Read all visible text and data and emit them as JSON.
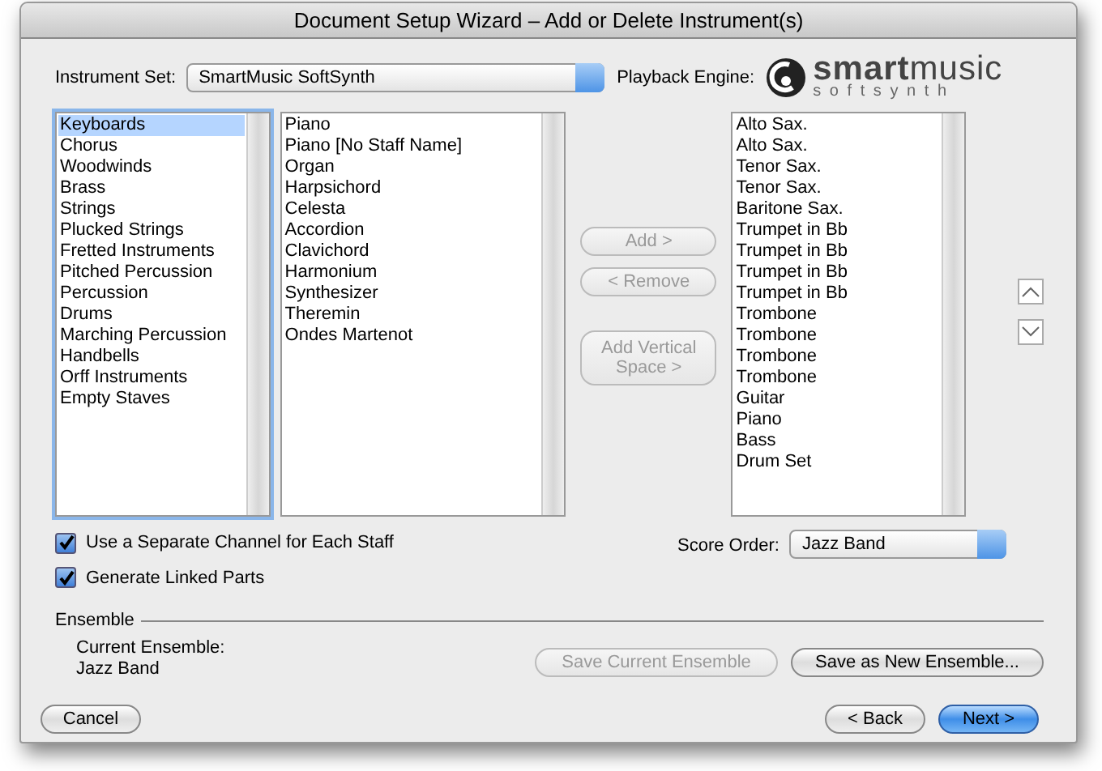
{
  "window": {
    "title": "Document Setup Wizard – Add or Delete Instrument(s)"
  },
  "instrument_set": {
    "label": "Instrument Set:",
    "value": "SmartMusic SoftSynth"
  },
  "playback_engine": {
    "label": "Playback Engine:",
    "logo_text": "**smart**music",
    "logo_tagline": "softsynth"
  },
  "categories": [
    {
      "label": "Keyboards",
      "selected": true
    },
    {
      "label": "Chorus",
      "selected": false
    },
    {
      "label": "Woodwinds",
      "selected": false
    },
    {
      "label": "Brass",
      "selected": false
    },
    {
      "label": "Strings",
      "selected": false
    },
    {
      "label": "Plucked Strings",
      "selected": false
    },
    {
      "label": "Fretted Instruments",
      "selected": false
    },
    {
      "label": "Pitched Percussion",
      "selected": false
    },
    {
      "label": "Percussion",
      "selected": false
    },
    {
      "label": "Drums",
      "selected": false
    },
    {
      "label": "Marching Percussion",
      "selected": false
    },
    {
      "label": "Handbells",
      "selected": false
    },
    {
      "label": "Orff Instruments",
      "selected": false
    },
    {
      "label": "Empty Staves",
      "selected": false
    }
  ],
  "instruments": [
    "Piano",
    "Piano [No Staff Name]",
    "Organ",
    "Harpsichord",
    "Celesta",
    "Accordion",
    "Clavichord",
    "Harmonium",
    "Synthesizer",
    "Theremin",
    "Ondes Martenot"
  ],
  "transfer_buttons": [
    {
      "label": "Add >",
      "disabled": true
    },
    {
      "label": "< Remove",
      "disabled": true
    },
    {
      "label": "Add Vertical Space >",
      "disabled": true
    }
  ],
  "score": [
    "Alto Sax.",
    "Alto Sax.",
    "Tenor Sax.",
    "Tenor Sax.",
    "Baritone Sax.",
    "Trumpet in Bb",
    "Trumpet in Bb",
    "Trumpet in Bb",
    "Trumpet in Bb",
    "Trombone",
    "Trombone",
    "Trombone",
    "Trombone",
    "Guitar",
    "Piano",
    "Bass",
    "Drum Set"
  ],
  "options": [
    {
      "label": "Use a Separate Channel for Each Staff",
      "checked": true
    },
    {
      "label": "Generate Linked Parts",
      "checked": true
    }
  ],
  "score_order": {
    "label": "Score Order:",
    "value": "Jazz Band"
  },
  "ensemble": {
    "heading": "Ensemble",
    "current_label": "Current Ensemble:",
    "current_value": "Jazz Band",
    "buttons": [
      {
        "label": "Save Current Ensemble",
        "disabled": true
      },
      {
        "label": "Save as New Ensemble...",
        "disabled": false
      }
    ]
  },
  "footer": {
    "left": [
      {
        "label": "Cancel",
        "default": false
      }
    ],
    "right": [
      {
        "label": "< Back",
        "default": false
      },
      {
        "label": "Next >",
        "default": true
      }
    ]
  }
}
